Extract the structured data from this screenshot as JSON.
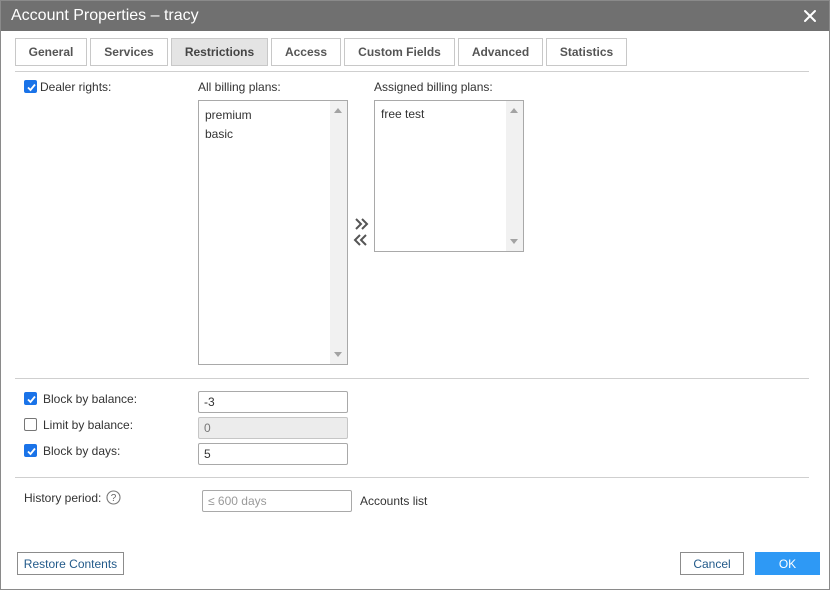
{
  "window": {
    "title": "Account Properties – tracy"
  },
  "tabs": [
    {
      "label": "General",
      "active": false
    },
    {
      "label": "Services",
      "active": false
    },
    {
      "label": "Restrictions",
      "active": true
    },
    {
      "label": "Access",
      "active": false
    },
    {
      "label": "Custom Fields",
      "active": false
    },
    {
      "label": "Advanced",
      "active": false
    },
    {
      "label": "Statistics",
      "active": false
    }
  ],
  "dealer": {
    "label": "Dealer rights:",
    "checked": true
  },
  "billing": {
    "all_label": "All billing plans:",
    "all_items": [
      "premium",
      "basic"
    ],
    "assigned_label": "Assigned billing plans:",
    "assigned_items": [
      "free test"
    ]
  },
  "balance": {
    "block_label": "Block by balance:",
    "block_checked": true,
    "block_value": "-3",
    "limit_label": "Limit by balance:",
    "limit_checked": false,
    "limit_value": "0",
    "days_label": "Block by days:",
    "days_checked": true,
    "days_value": "5"
  },
  "history": {
    "label": "History period:",
    "placeholder": "≤ 600 days",
    "accounts_link": "Accounts list"
  },
  "footer": {
    "restore_label": "Restore Contents",
    "cancel_label": "Cancel",
    "ok_label": "OK"
  },
  "colors": {
    "titlebar": "#707070",
    "accent": "#2e99f5",
    "checkbox": "#1a73e8"
  }
}
